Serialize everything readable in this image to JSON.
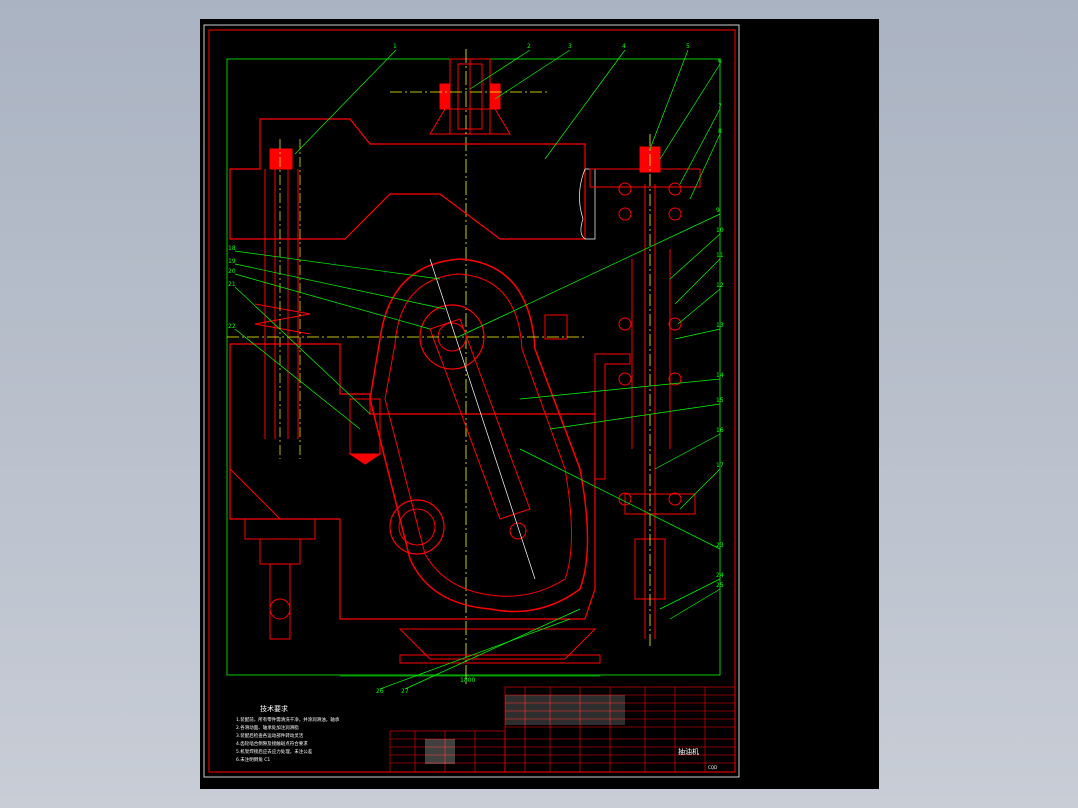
{
  "drawing": {
    "dimension_label": "1800",
    "notes_title": "技术要求",
    "notes_lines": [
      "1.装配前，所有零件需清洗干净，并涂润滑油，轴承",
      "2.各滑动面、轴承处加注润滑脂",
      "3.装配后检查各运动部件转动灵活",
      "4.齿轮啮合侧隙及接触斑点符合要求",
      "5.机架焊接后应去应力处理，未注公差",
      "6.未注明倒角 C1"
    ],
    "title_block_name": "抽油机",
    "title_block_code": "CQD"
  },
  "colors": {
    "frame": "#ff0000",
    "leader": "#00ff00",
    "centerline": "#ffff00",
    "hatch": "#ffffff",
    "background": "#000000"
  },
  "callouts": [
    "1",
    "2",
    "3",
    "4",
    "5",
    "6",
    "7",
    "8",
    "9",
    "10",
    "11",
    "12",
    "13",
    "14",
    "15",
    "16",
    "17",
    "18",
    "19",
    "20",
    "21",
    "22",
    "23",
    "24",
    "25",
    "26",
    "27",
    "28",
    "29",
    "30",
    "31",
    "32",
    "33",
    "34",
    "35"
  ]
}
